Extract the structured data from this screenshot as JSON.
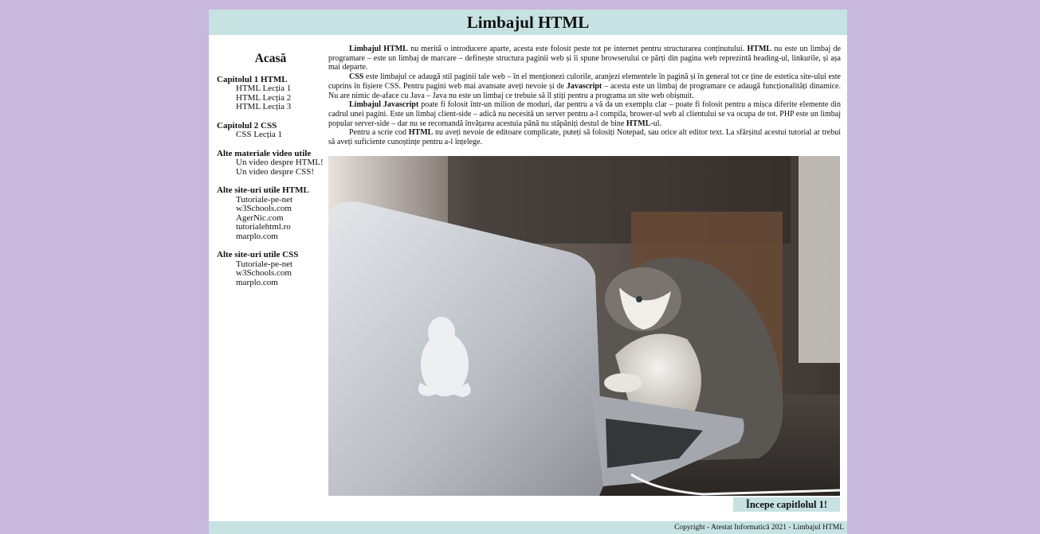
{
  "header": {
    "title": "Limbajul HTML"
  },
  "sidebar": {
    "home": "Acasă",
    "sections": [
      {
        "title": "Capitolul 1 HTML",
        "links": [
          "HTML Lecția 1",
          "HTML Lecția 2",
          "HTML Lecția 3"
        ]
      },
      {
        "title": "Capitolul 2 CSS",
        "links": [
          "CSS Lecția 1"
        ]
      },
      {
        "title": "Alte materiale video utile",
        "links": [
          "Un video despre HTML!",
          "Un video despre CSS!"
        ]
      },
      {
        "title": "Alte site-uri utile HTML",
        "links": [
          "Tutoriale-pe-net",
          "w3Schools.com",
          "AgerNic.com",
          "tutorialehtml.ro",
          "marplo.com"
        ]
      },
      {
        "title": "Alte site-uri utile CSS",
        "links": [
          "Tutoriale-pe-net",
          "w3Schools.com",
          "marplo.com"
        ]
      }
    ]
  },
  "content": {
    "p1": {
      "b1": "Limbajul HTML",
      "t1": " nu merită o introducere aparte, acesta este folosit peste tot pe internet pentru structurarea conținutului. ",
      "b2": "HTML",
      "t2": " nu este un limbaj de programare – este un limbaj de marcare – definește structura paginii web și îi spune browserului ce părți din pagina web reprezintă heading-ul, linkurile, și așa mai departe."
    },
    "p2": {
      "b1": "CSS",
      "t1": " este limbajul ce adaugă stil paginii tale web – în el menționezi culorile, aranjezi elementele în pagină și în general tot ce ține de estetica site-ului este cuprins în fișiere CSS. Pentru pagini web mai avansate aveți nevoie și de ",
      "b2": "Javascript",
      "t2": " – acesta este un limbaj de programare ce adaugă funcționalități dinamice. Nu are nimic de-aface cu Java – Java nu este un limbaj ce trebuie să îl știți pentru a programa un site web obișnuit."
    },
    "p3": {
      "b1": "Limbajul Javascript",
      "t1": " poate fi folosit într-un milion de moduri, dar pentru a vă da un exemplu clar – poate fi folosit pentru a mișca diferite elemente din cadrul unei pagini. Este un limbaj client-side – adică nu necesită un server pentru a-l compila, brower-ul web al clientului se va ocupa de tot. PHP este un limbaj popular server-side – dar nu se recomandă învățarea acestuia până nu stăpâniți destul de bine ",
      "b2": "HTML",
      "t2": "-ul."
    },
    "p4": {
      "t0": "Pentru a scrie cod ",
      "b1": "HTML",
      "t1": " nu aveți nevoie de editoare complicate, puteți să folosiți Notepad, sau orice alt editor text. La sfârșitul acestui tutorial ar trebui să aveți suficiente cunoștințe pentru a-l înțelege."
    }
  },
  "start_button": "Începe capitlolul 1!",
  "footer": "Copyright - Atestat Informatică 2021 - Limbajul HTML",
  "colors": {
    "background": "#c8b8dd",
    "header_bar": "#c6e2e2",
    "page": "#ffffff"
  }
}
